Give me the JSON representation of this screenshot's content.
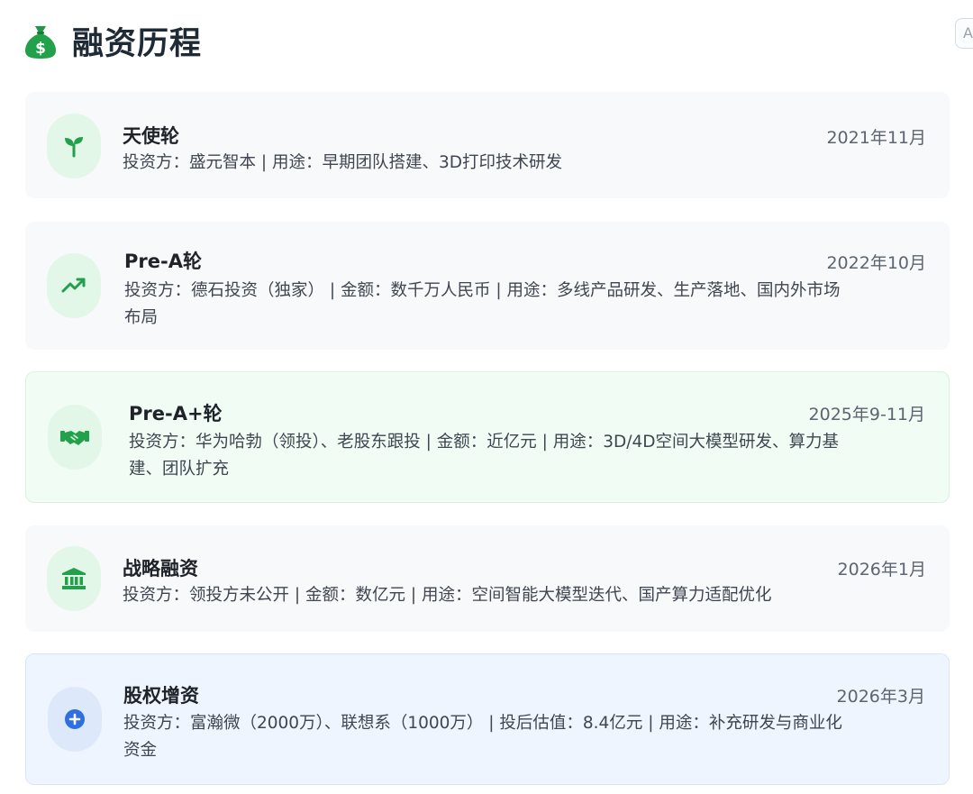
{
  "header": {
    "icon": "money-bag-icon",
    "title": "融资历程"
  },
  "corner_button": {
    "label": "A"
  },
  "colors": {
    "accent_green": "#22a04b",
    "accent_blue": "#2f6fe0",
    "card_default": "#f8f9fb",
    "card_highlight_green": "#f0fcf4",
    "card_highlight_blue": "#eff5fe"
  },
  "rounds": [
    {
      "icon": "seedling-icon",
      "title": "天使轮",
      "date": "2021年11月",
      "description": "投资方：盛元智本 | 用途：早期团队搭建、3D打印技术研发"
    },
    {
      "icon": "trending-up-icon",
      "title": "Pre-A轮",
      "date": "2022年10月",
      "description_lines": [
        "投资方：德石投资（独家） | 金额：数千万人民币 | 用途：多线产品研发、生产落地、国内外市场",
        "布局"
      ]
    },
    {
      "icon": "handshake-icon",
      "title": "Pre-A+轮",
      "date": "2025年9-11月",
      "description_lines": [
        "投资方：华为哈勃（领投）、老股东跟投 | 金额：近亿元 | 用途：3D/4D空间大模型研发、算力基",
        "建、团队扩充"
      ]
    },
    {
      "icon": "bank-icon",
      "title": "战略融资",
      "date": "2026年1月",
      "description": "投资方：领投方未公开 | 金额：数亿元 | 用途：空间智能大模型迭代、国产算力适配优化"
    },
    {
      "icon": "plus-circle-icon",
      "title": "股权增资",
      "date": "2026年3月",
      "description_lines": [
        "投资方：富瀚微（2000万）、联想系（1000万） | 投后估值：8.4亿元 | 用途：补充研发与商业化",
        "资金"
      ]
    }
  ]
}
